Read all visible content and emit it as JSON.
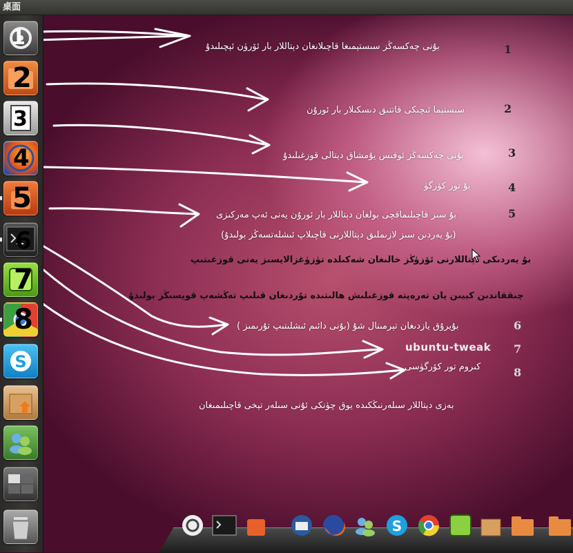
{
  "topbar": {
    "title": "桌面"
  },
  "launcher": {
    "items": [
      {
        "id": "ubuntu-tweak",
        "icon": "ubuntu-tweak-icon",
        "number": "1",
        "color": "#5a5a5a"
      },
      {
        "id": "files",
        "icon": "folder-icon",
        "number": "2",
        "color": "#d4622a"
      },
      {
        "id": "text-editor",
        "icon": "text-editor-icon",
        "number": "3",
        "color": "#bdbdbd"
      },
      {
        "id": "firefox",
        "icon": "firefox-icon",
        "number": "4",
        "color": "#e36a1e"
      },
      {
        "id": "software-center",
        "icon": "software-center-icon",
        "number": "5",
        "color": "#d8501e"
      },
      {
        "id": "terminal",
        "icon": "terminal-icon",
        "number": "6",
        "color": "#3a3a3a"
      },
      {
        "id": "ubuntu-tweak-2",
        "icon": "tweak-green-icon",
        "number": "7",
        "color": "#6cc02a"
      },
      {
        "id": "chrome",
        "icon": "chrome-icon",
        "number": "8",
        "color": "#e0d040"
      },
      {
        "id": "skype",
        "icon": "skype-icon",
        "number": "",
        "color": "#1ea0e0"
      },
      {
        "id": "package-installer",
        "icon": "package-icon",
        "number": "",
        "color": "#c89050"
      },
      {
        "id": "empathy",
        "icon": "chat-icon",
        "number": "",
        "color": "#5a9a3a"
      },
      {
        "id": "workspace-switcher",
        "icon": "workspace-icon",
        "number": "",
        "color": "#555555"
      },
      {
        "id": "trash",
        "icon": "trash-icon",
        "number": "",
        "color": "#888888"
      }
    ]
  },
  "annotations": [
    {
      "num": "1",
      "text": "بۇنى چەكسەڭز سىستېمىغا قاچىلانغان دېتاللار بار ئۆرۈن ئېچىلىدۇ"
    },
    {
      "num": "2",
      "text": "سىستېما ئىچىكى قاتتىق دىسكىلار بار ئورۇن"
    },
    {
      "num": "3",
      "text": "بۇنى چەكسەڭز ئوفىس يۇمشاق دېتالى قوزغىلىدۇ"
    },
    {
      "num": "4",
      "text": "بۇ تور كۆرگۈ"
    },
    {
      "num": "5",
      "text": "بۇ سىز قاچىلىماقچى بولغان دېتاللار بار ئورۇن يەنى ئەپ مەركىزى"
    },
    {
      "num": "",
      "text": "(بۇ يەردىن سىز لازىملىق دېتاللارنى قاچىلاپ ئىشلەتسەڭز بولىدۇ)"
    },
    {
      "num": "",
      "text": "بۇ يەردىكى دېتاللارنى ئۆزۈڭز خالىغان شەكىلدە تۈزۈغزالايسىز يەنى قوزغىتىپ"
    },
    {
      "num": "",
      "text": "چىققاندىن كېيىن يان تەرەپتە قوزغىلىش ھالىتىدە تۇردىغان قىلىپ تەڭشەپ قويسىڭز بولىدۇ"
    },
    {
      "num": "6",
      "text": "بۇيرۇق يازدىغان تېرمىنال شۇ (بۇنى دائىم ئىشلىتىپ تۇرىمىز )"
    },
    {
      "num": "7",
      "text": "ubuntu-tweak"
    },
    {
      "num": "8",
      "text": "كىروم تور كۆرگۈسى"
    },
    {
      "num": "",
      "text": "بەزى دېتاللار سىلەرنىڭكىدە يوق چۈنكى ئۇنى سىلەر تېخى قاچىلىمىغان"
    }
  ],
  "dock": {
    "items": [
      {
        "id": "ubuntu",
        "icon": "ubuntu-logo-icon",
        "color": "#e8e8e8"
      },
      {
        "id": "terminal",
        "icon": "terminal-icon",
        "color": "#333333"
      },
      {
        "id": "software",
        "icon": "software-center-icon",
        "color": "#d8501e"
      },
      {
        "id": "thunderbird",
        "icon": "thunderbird-icon",
        "color": "#2a5aa0"
      },
      {
        "id": "firefox",
        "icon": "firefox-icon",
        "color": "#e36a1e"
      },
      {
        "id": "empathy",
        "icon": "chat-icon",
        "color": "#5a9a3a"
      },
      {
        "id": "skype",
        "icon": "skype-icon",
        "color": "#1ea0e0"
      },
      {
        "id": "chrome",
        "icon": "chrome-icon",
        "color": "#e04030"
      },
      {
        "id": "tweak",
        "icon": "tweak-green-icon",
        "color": "#6cc02a"
      },
      {
        "id": "package",
        "icon": "package-icon",
        "color": "#c89050"
      },
      {
        "id": "home-folder",
        "icon": "home-folder-icon",
        "color": "#e07030"
      },
      {
        "id": "home-folder-2",
        "icon": "home-folder-icon",
        "color": "#e07030"
      }
    ]
  }
}
